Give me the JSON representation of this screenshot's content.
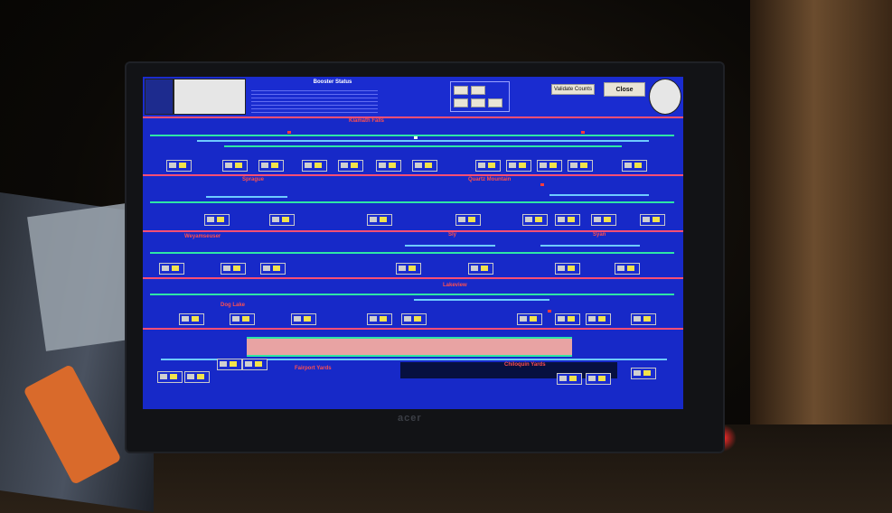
{
  "header": {
    "status_title": "Booster Status",
    "validate_label": "Validate Counts",
    "close_label": "Close"
  },
  "sections": {
    "klamath": "Klamath Falls",
    "sprague": "Sprague",
    "quartz": "Quartz Mountain",
    "weyam": "Weyamseuser",
    "sly": "Sly",
    "syan": "Syan",
    "lakeview": "Lakeview",
    "doglake": "Dog Lake"
  },
  "yards": {
    "fairport": "Fairport Yards",
    "chiloquin": "Chiloquin Yards"
  },
  "colors": {
    "screen_bg": "#1729c8",
    "track": "#2ee6a6",
    "division_line": "#ff4f74",
    "label_red": "#ff4f4f"
  }
}
